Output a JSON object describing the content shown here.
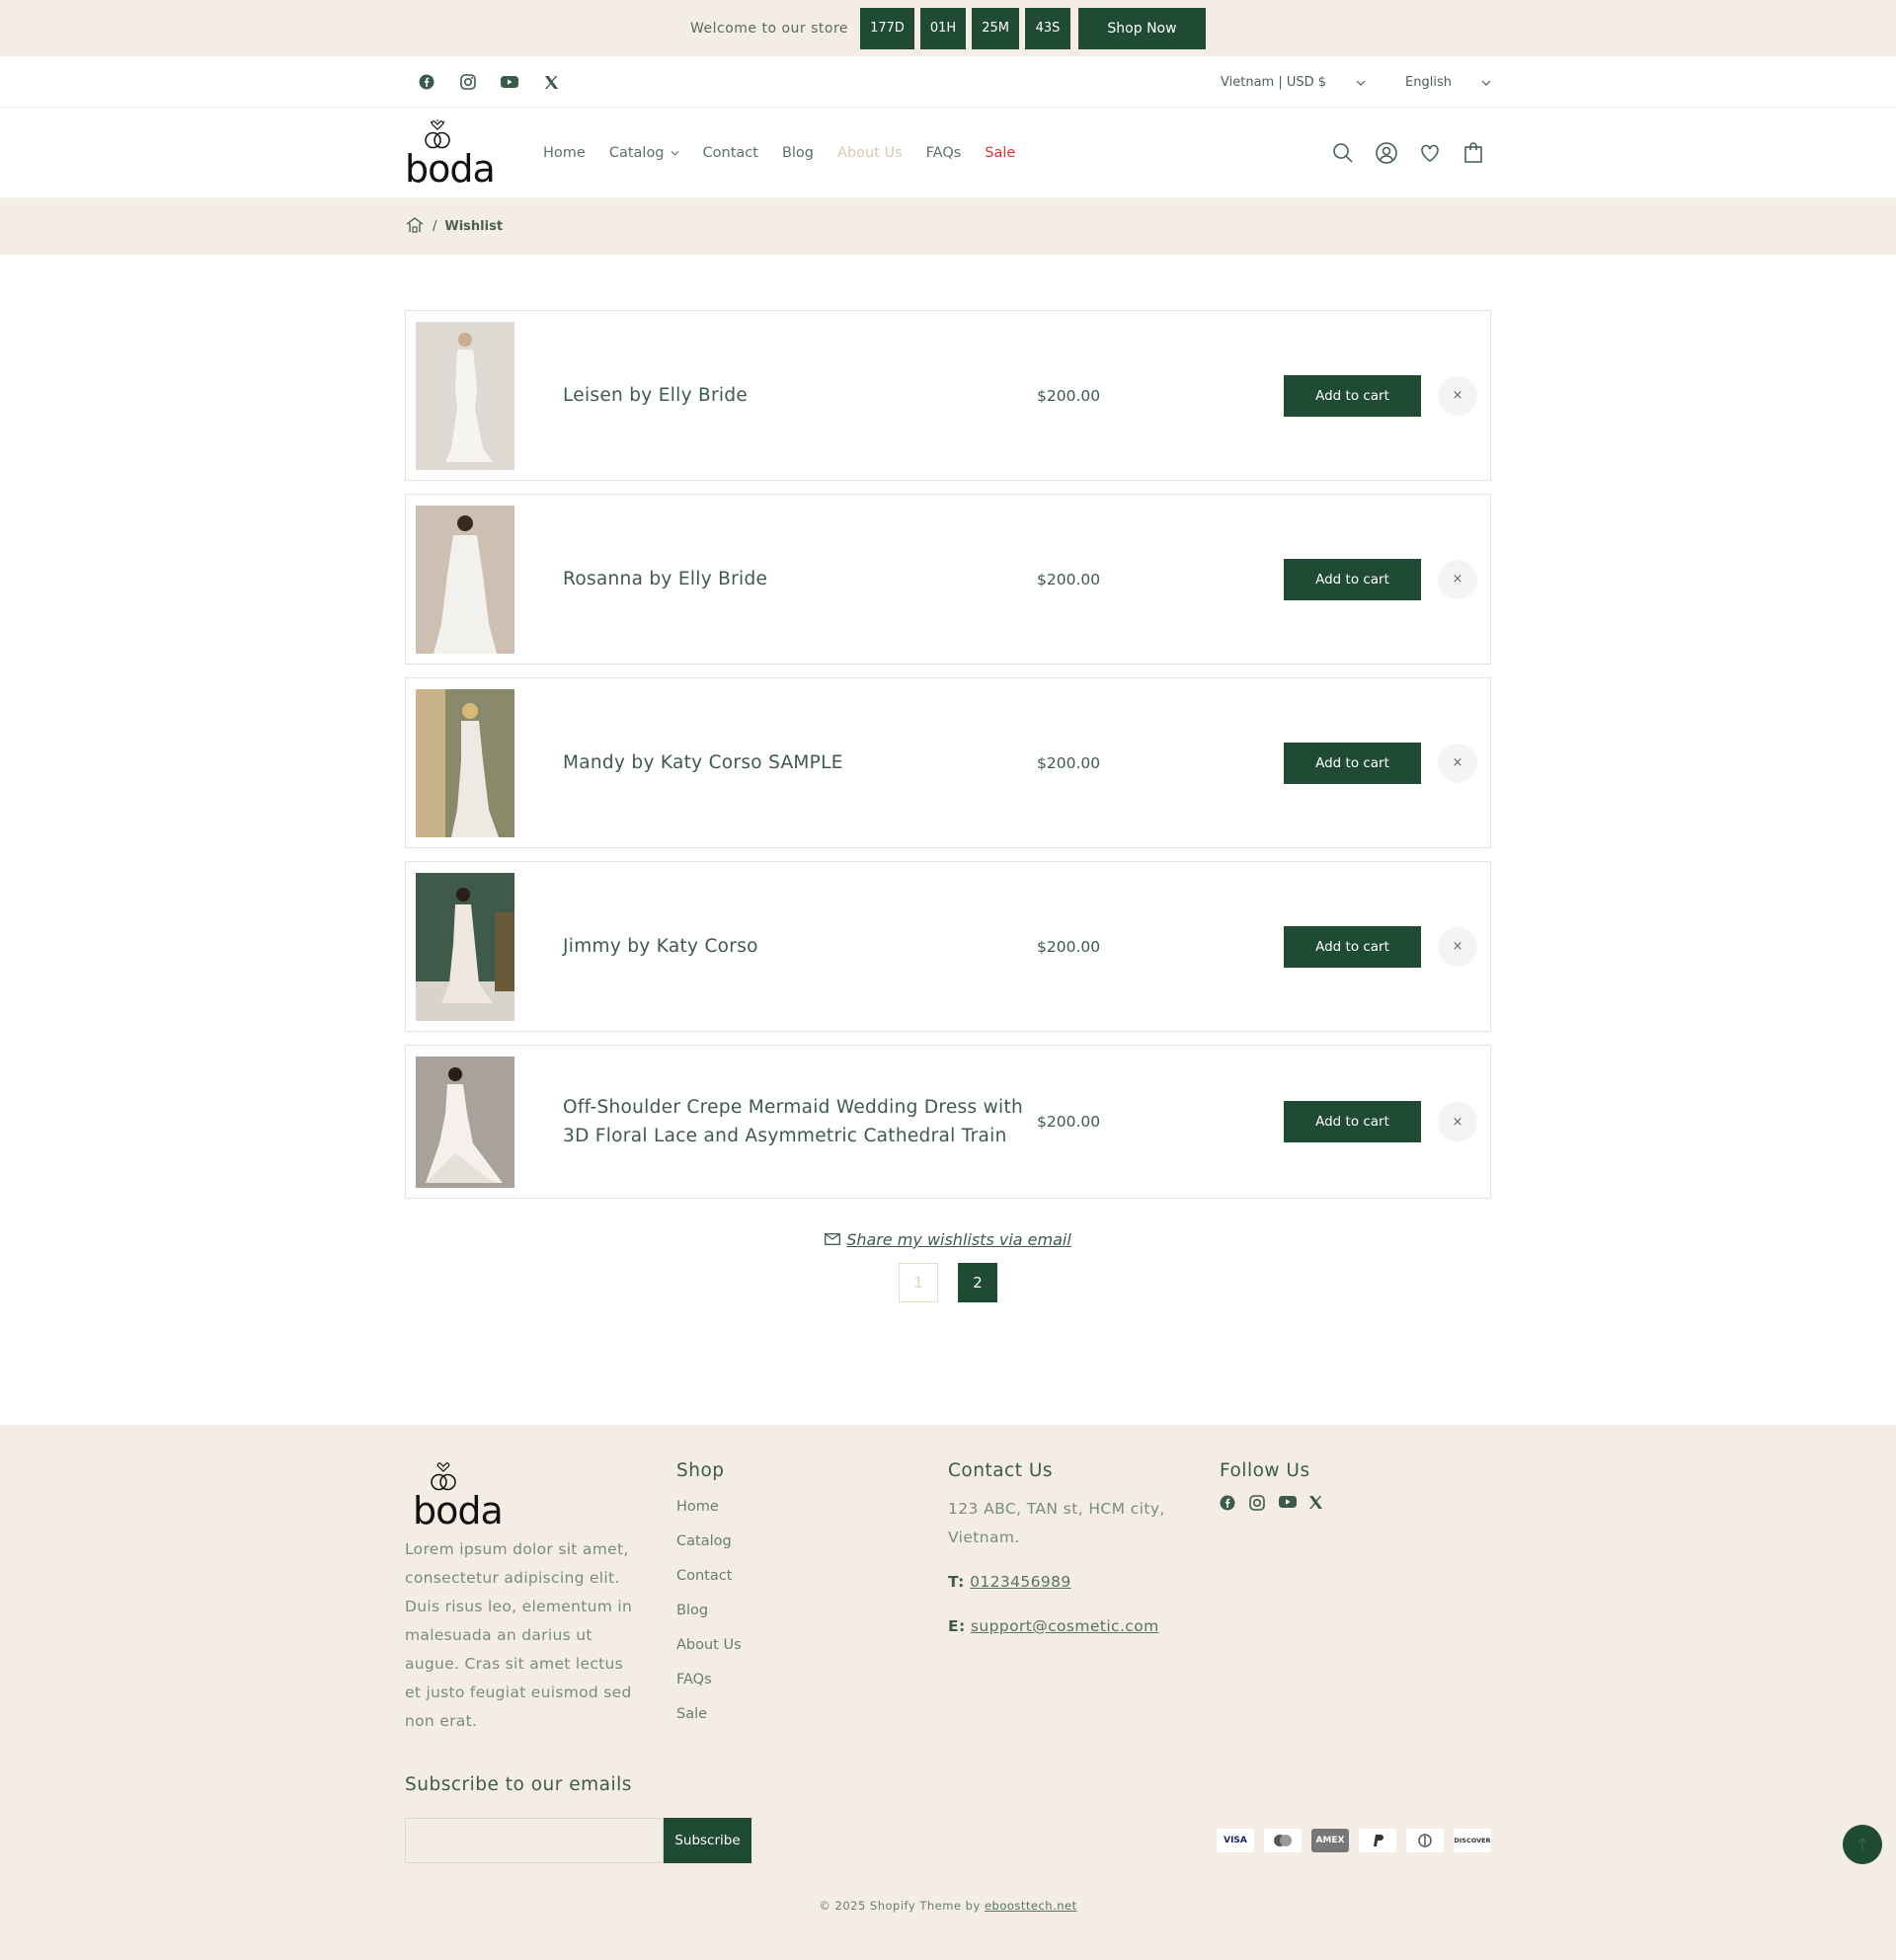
{
  "announcement": {
    "text": "Welcome to our store",
    "countdown": [
      "177D",
      "01H",
      "25M",
      "43S"
    ],
    "cta": "Shop Now"
  },
  "utility": {
    "region": "Vietnam",
    "currency": "USD $",
    "language": "English"
  },
  "header": {
    "logo_text": "boda",
    "nav": [
      {
        "label": "Home"
      },
      {
        "label": "Catalog"
      },
      {
        "label": "Contact"
      },
      {
        "label": "Blog"
      },
      {
        "label": "About Us"
      },
      {
        "label": "FAQs"
      },
      {
        "label": "Sale"
      }
    ]
  },
  "breadcrumb": {
    "separator": "/",
    "current": "Wishlist"
  },
  "wishlist": {
    "items": [
      {
        "name": "Leisen by Elly Bride",
        "price": "$200.00",
        "button": "Add to cart",
        "remove": "×"
      },
      {
        "name": "Rosanna by Elly Bride",
        "price": "$200.00",
        "button": "Add to cart",
        "remove": "×"
      },
      {
        "name": "Mandy by Katy Corso SAMPLE",
        "price": "$200.00",
        "button": "Add to cart",
        "remove": "×"
      },
      {
        "name": "Jimmy by Katy Corso",
        "price": "$200.00",
        "button": "Add to cart",
        "remove": "×"
      },
      {
        "name": "Off-Shoulder Crepe Mermaid Wedding Dress with 3D Floral Lace and Asymmetric Cathedral Train",
        "price": "$200.00",
        "button": "Add to cart",
        "remove": "×"
      }
    ],
    "share": "Share my wishlists via email",
    "pages": [
      "1",
      "2"
    ]
  },
  "footer": {
    "logo_text": "boda",
    "about": "Lorem ipsum dolor sit amet, consectetur adipiscing elit. Duis risus leo, elementum in malesuada an darius ut augue. Cras sit amet lectus et justo feugiat euismod sed non erat.",
    "shop_title": "Shop",
    "shop_links": [
      "Home",
      "Catalog",
      "Contact",
      "Blog",
      "About Us",
      "FAQs",
      "Sale"
    ],
    "contact_title": "Contact Us",
    "address": "123 ABC, TAN st, HCM city, Vietnam.",
    "phone_label": "T:",
    "phone": "0123456989",
    "email_label": "E:",
    "email": "support@cosmetic.com",
    "follow_title": "Follow Us",
    "subscribe_title": "Subscribe to our emails",
    "subscribe_button": "Subscribe",
    "payments": [
      "VISA",
      "Mastercard",
      "AMEX",
      "PayPal",
      "Diners",
      "DISCOVER"
    ],
    "copyright": "© 2025  Shopify Theme by",
    "credit": "eboosttech.net"
  },
  "colors": {
    "brand": "#1f4a33",
    "cream": "#f3ede3",
    "sale": "#e0332d"
  }
}
